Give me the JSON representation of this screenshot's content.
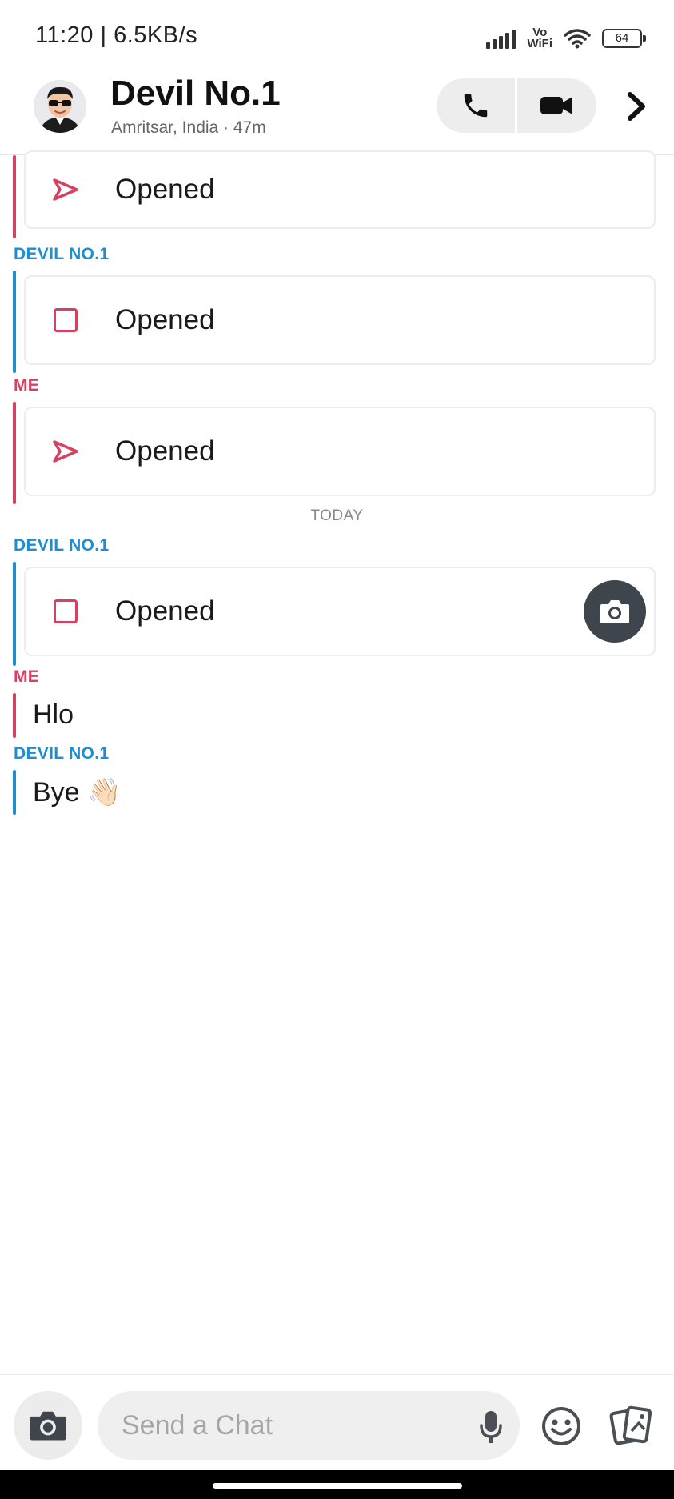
{
  "status_bar": {
    "time_speed": "11:20 | 6.5KB/s",
    "vowifi_top": "Vo",
    "vowifi_bottom": "WiFi",
    "battery": "64"
  },
  "header": {
    "name": "Devil No.1",
    "location_time": "Amritsar, India · 47m",
    "avatar": "bitmoji-avatar-icon",
    "buttons": [
      "phone-icon",
      "video-icon",
      "chevron-right-icon"
    ]
  },
  "chat": {
    "day_separator": "TODAY",
    "messages": [
      {
        "sender": "",
        "kind": "snap-sent",
        "text": "Opened"
      },
      {
        "sender": "DEVIL NO.1",
        "kind": "snap-received",
        "text": "Opened"
      },
      {
        "sender": "ME",
        "kind": "snap-sent",
        "text": "Opened"
      },
      {
        "sender": "DEVIL NO.1",
        "kind": "snap-received",
        "text": "Opened"
      },
      {
        "sender": "ME",
        "kind": "text",
        "text": "Hlo"
      },
      {
        "sender": "DEVIL NO.1",
        "kind": "text",
        "text": "Bye 👋🏻"
      }
    ]
  },
  "input": {
    "placeholder": "Send a Chat"
  },
  "colors": {
    "me": "#d5425f",
    "them": "#1d8fd0"
  }
}
